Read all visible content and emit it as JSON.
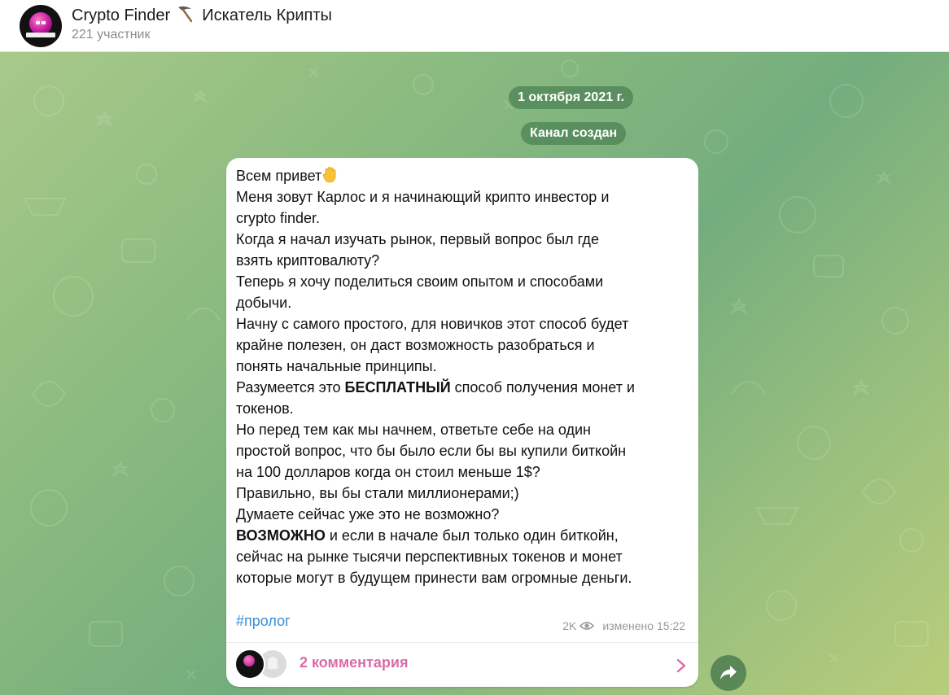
{
  "header": {
    "channel_title": "Crypto Finder",
    "channel_title_rest": "Искатель Крипты",
    "members": "221 участник",
    "title_icon": "pickaxe-icon"
  },
  "chat": {
    "date_pill": "1 октября 2021 г.",
    "service_pill": "Канал создан",
    "message": {
      "lines": [
        "Всем привет",
        "Меня зовут Карлос и я начинающий крипто инвестор и",
        "crypto finder.",
        "Когда я начал изучать рынок, первый вопрос был где",
        "взять криптовалюту?",
        "Теперь я хочу поделиться своим опытом и способами",
        "добычи.",
        "Начну с самого простого, для новичков этот способ будет",
        "крайне полезен, он даст возможность разобраться и",
        "понять начальные принципы.",
        "Разумеется это ",
        "БЕСПЛАТНЫЙ",
        " способ получения монет и",
        "токенов.",
        "Но перед тем как мы начнем, ответьте себе на один",
        "простой вопрос, что бы было если бы вы купили биткойн",
        "на 100 долларов когда он стоил меньше 1$?",
        "Правильно, вы бы стали миллионерами;)",
        "Думаете сейчас уже это не возможно?",
        "ВОЗМОЖНО",
        " и если в начале был только один биткойн,",
        "сейчас на рынке тысячи перспективных токенов и монет",
        "которые могут в будущем принести вам огромные деньги."
      ],
      "hashtag": "#пролог",
      "views": "2K",
      "edited": "изменено 15:22",
      "comments": "2 комментария"
    }
  },
  "colors": {
    "comments_accent": "#d96ca7",
    "hashtag": "#3a8ed6",
    "pill_bg": "#4e8454"
  }
}
